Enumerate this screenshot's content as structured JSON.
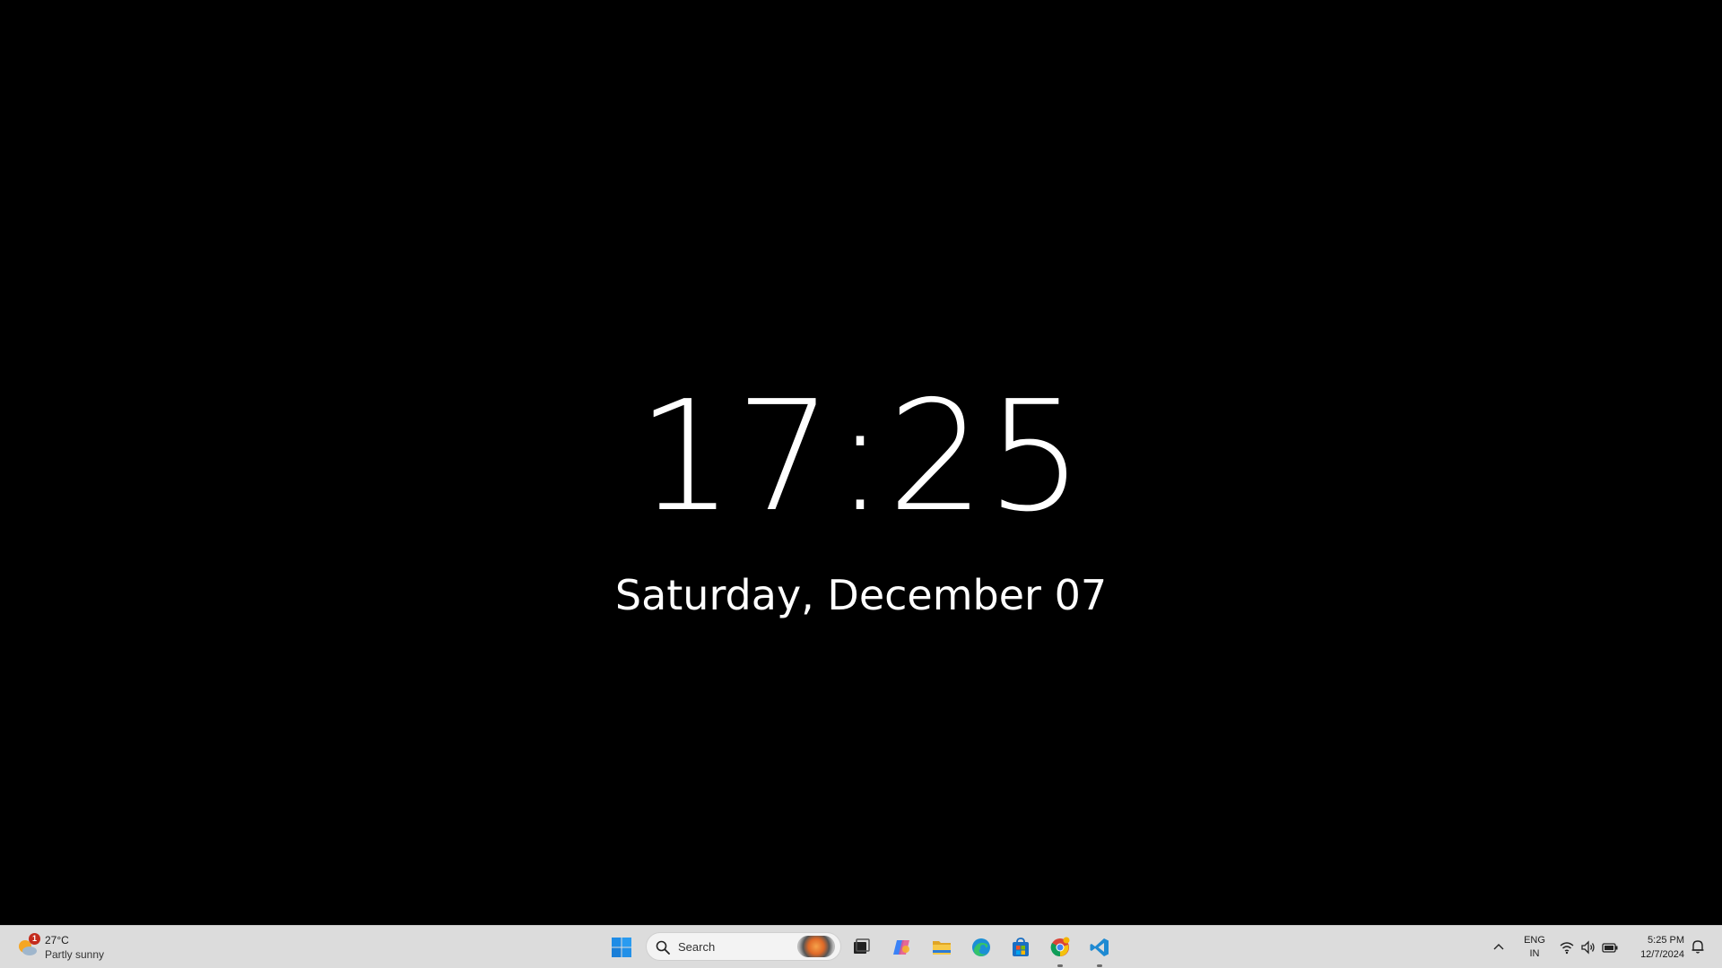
{
  "lockscreen": {
    "time": "17:25",
    "date": "Saturday, December 07"
  },
  "taskbar": {
    "weather": {
      "temperature": "27°C",
      "condition": "Partly sunny",
      "badge_count": "1",
      "icon": "partly-sunny-icon"
    },
    "search": {
      "label": "Search",
      "icon": "search-icon"
    },
    "pinned_apps": [
      {
        "name": "Start",
        "icon": "windows-start-icon"
      },
      {
        "name": "Task View",
        "icon": "task-view-icon"
      },
      {
        "name": "Copilot",
        "icon": "copilot-icon"
      },
      {
        "name": "File Explorer",
        "icon": "folder-icon"
      },
      {
        "name": "Microsoft Edge",
        "icon": "edge-icon"
      },
      {
        "name": "Microsoft Store",
        "icon": "store-icon"
      },
      {
        "name": "Google Chrome",
        "icon": "chrome-icon",
        "running": true
      },
      {
        "name": "Visual Studio Code",
        "icon": "vscode-icon",
        "running": true
      }
    ],
    "tray": {
      "language_line1": "ENG",
      "language_line2": "IN",
      "clock_time": "5:25 PM",
      "clock_date": "12/7/2024"
    }
  },
  "colors": {
    "background": "#000000",
    "taskbar": "#dcdcdc",
    "text": "#ffffff",
    "accent": "#0078d4"
  }
}
